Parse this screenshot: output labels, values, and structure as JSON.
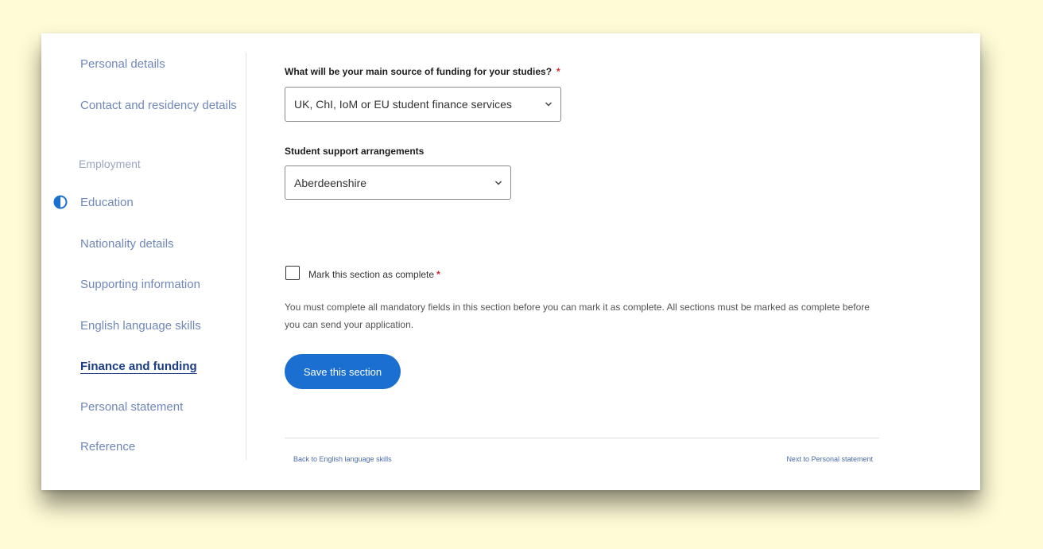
{
  "sidebar": {
    "items": [
      {
        "label": "Personal details"
      },
      {
        "label": "Contact and residency details"
      },
      {
        "label": "Employment"
      },
      {
        "label": "Education"
      },
      {
        "label": "Nationality details"
      },
      {
        "label": "Supporting information"
      },
      {
        "label": "English language skills"
      },
      {
        "label": "Finance and funding"
      },
      {
        "label": "Personal statement"
      },
      {
        "label": "Reference"
      }
    ],
    "active_index": 7,
    "in_progress_icon": "half-circle-icon"
  },
  "form": {
    "funding_question": "What will be your main source of funding for your studies?",
    "required_mark": "*",
    "funding_value": "UK, ChI, IoM or EU student finance services",
    "support_label": "Student support arrangements",
    "support_value": "Aberdeenshire",
    "complete_label": "Mark this section as complete",
    "complete_checked": false,
    "help_text": "You must complete all mandatory fields in this section before you can mark it as complete. All sections must be marked as complete before you can send your application.",
    "save_label": "Save this section"
  },
  "footer": {
    "back_label": "Back to English language skills",
    "next_label": "Next to Personal statement"
  },
  "colors": {
    "page_background": "#fffbd6",
    "accent": "#1a6fd0",
    "required": "#d9232e",
    "nav_link": "#6f87b9",
    "nav_active": "#1b3c84"
  }
}
